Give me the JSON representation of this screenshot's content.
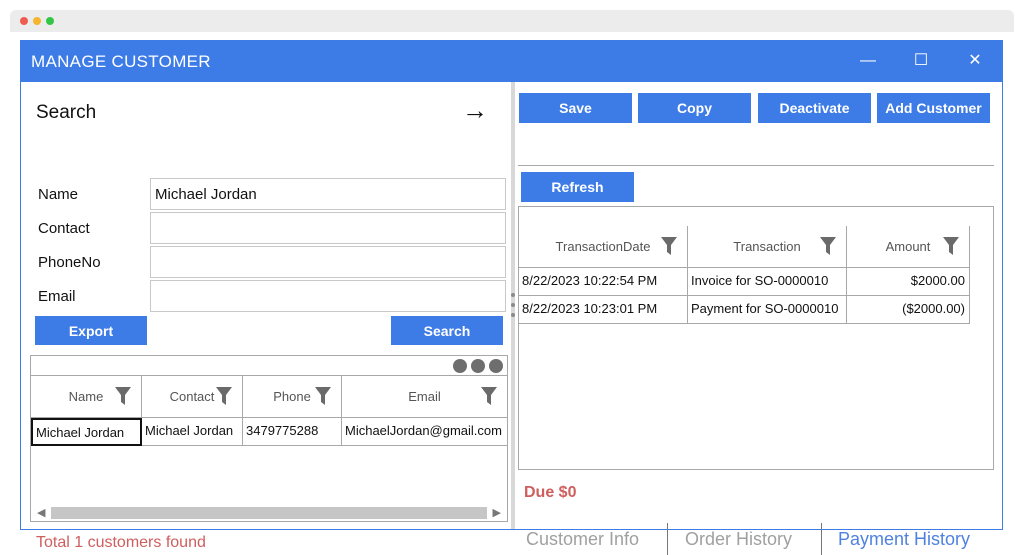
{
  "window": {
    "title": "MANAGE CUSTOMER",
    "minimize": "—",
    "maximize": "☐",
    "close": "✕"
  },
  "search": {
    "title": "Search",
    "arrow": "→",
    "fields": [
      {
        "label": "Name",
        "value": "Michael Jordan"
      },
      {
        "label": "Contact",
        "value": ""
      },
      {
        "label": "PhoneNo",
        "value": ""
      },
      {
        "label": "Email",
        "value": ""
      }
    ],
    "export_label": "Export",
    "search_label": "Search"
  },
  "customers": {
    "columns": [
      "Name",
      "Contact",
      "Phone",
      "Email"
    ],
    "rows": [
      [
        "Michael Jordan",
        "Michael Jordan",
        "3479775288",
        "MichaelJordan@gmail.com"
      ]
    ],
    "total_text": "Total 1 customers found"
  },
  "toolbar": {
    "save": "Save",
    "copy": "Copy",
    "deactivate": "Deactivate",
    "add_customer": "Add Customer",
    "refresh": "Refresh"
  },
  "transactions": {
    "columns": [
      "TransactionDate",
      "Transaction",
      "Amount"
    ],
    "rows": [
      [
        "8/22/2023 10:22:54 PM",
        "Invoice for SO-0000010",
        "$2000.00"
      ],
      [
        "8/22/2023 10:23:01 PM",
        "Payment for SO-0000010",
        "($2000.00)"
      ]
    ],
    "due": "Due $0"
  },
  "tabs": [
    {
      "label": "Customer Info",
      "active": false
    },
    {
      "label": "Order History",
      "active": false
    },
    {
      "label": "Payment History",
      "active": true
    }
  ],
  "colors": {
    "accent": "#3d7be6",
    "alert": "#cf5e5e",
    "tab_inactive": "#a0a0a0",
    "tab_active": "#4f82e0"
  }
}
